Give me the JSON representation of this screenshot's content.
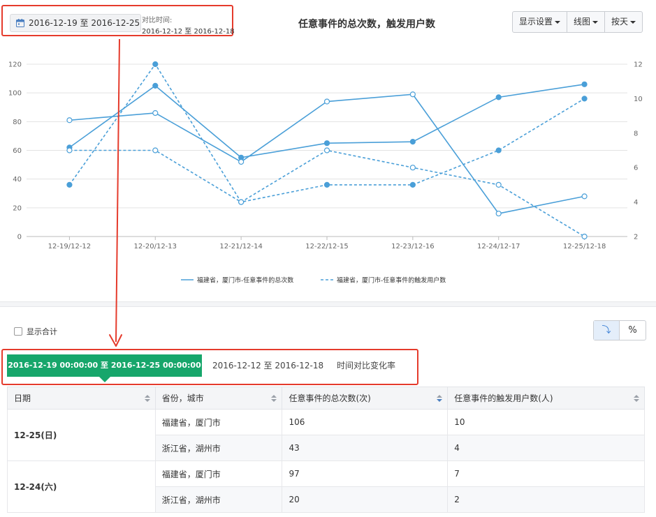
{
  "header": {
    "date_range": "2016-12-19 至 2016-12-25",
    "compare_label": "对比时间:",
    "compare_range": "2016-12-12 至 2016-12-18",
    "chart_title": "任意事件的总次数，触发用户数",
    "buttons": {
      "display_settings": "显示设置",
      "chart_type": "线图",
      "granularity": "按天"
    }
  },
  "chart_data": {
    "type": "line",
    "categories": [
      "12-19/12-12",
      "12-20/12-13",
      "12-21/12-14",
      "12-22/12-15",
      "12-23/12-16",
      "12-24/12-17",
      "12-25/12-18"
    ],
    "left_axis": {
      "ylim": [
        0,
        120
      ],
      "ticks": [
        "0",
        "20",
        "40",
        "60",
        "80",
        "100",
        "120"
      ]
    },
    "right_axis": {
      "ylim": [
        2,
        12
      ],
      "ticks": [
        "2",
        "4",
        "6",
        "8",
        "10",
        "12"
      ]
    },
    "series": [
      {
        "name": "福建省，厦门市-任意事件的总次数",
        "axis": "left",
        "style": "solid",
        "period": "current",
        "values": [
          62,
          105,
          55,
          65,
          66,
          97,
          106
        ]
      },
      {
        "name": "福建省，厦门市-任意事件的总次数",
        "axis": "left",
        "style": "solid",
        "period": "compare",
        "values": [
          81,
          86,
          52,
          94,
          99,
          16,
          28
        ]
      },
      {
        "name": "福建省，厦门市-任意事件的触发用户数",
        "axis": "right",
        "style": "dashed",
        "period": "current",
        "values": [
          5,
          12,
          4,
          5,
          5,
          7,
          10
        ]
      },
      {
        "name": "福建省，厦门市-任意事件的触发用户数",
        "axis": "right",
        "style": "dashed",
        "period": "compare",
        "values": [
          7,
          7,
          4,
          7,
          6,
          5,
          2
        ]
      }
    ],
    "legend": [
      "福建省，厦门市-任意事件的总次数",
      "福建省，厦门市-任意事件的触发用户数"
    ],
    "legend_position": "bottom",
    "grid": true,
    "color": "#4a9fd8"
  },
  "controls": {
    "show_total": "显示合计",
    "toggle_icon": "⤵",
    "toggle_percent": "%"
  },
  "tabs": {
    "active": "2016-12-19 00:00:00 至 2016-12-25 00:00:00",
    "compare": "2016-12-12 至 2016-12-18",
    "change_rate": "时间对比变化率"
  },
  "table": {
    "headers": [
      "日期",
      "省份，城市",
      "任意事件的总次数(次)",
      "任意事件的触发用户数(人)"
    ],
    "groups": [
      {
        "date": "12-25(日)",
        "rows": [
          [
            "福建省，厦门市",
            "106",
            "10"
          ],
          [
            "浙江省，湖州市",
            "43",
            "4"
          ]
        ]
      },
      {
        "date": "12-24(六)",
        "rows": [
          [
            "福建省，厦门市",
            "97",
            "7"
          ],
          [
            "浙江省，湖州市",
            "20",
            "2"
          ]
        ]
      }
    ]
  },
  "colors": {
    "accent_green": "#17a66b",
    "line_blue": "#4a9fd8",
    "highlight_red": "#e53b2c"
  }
}
